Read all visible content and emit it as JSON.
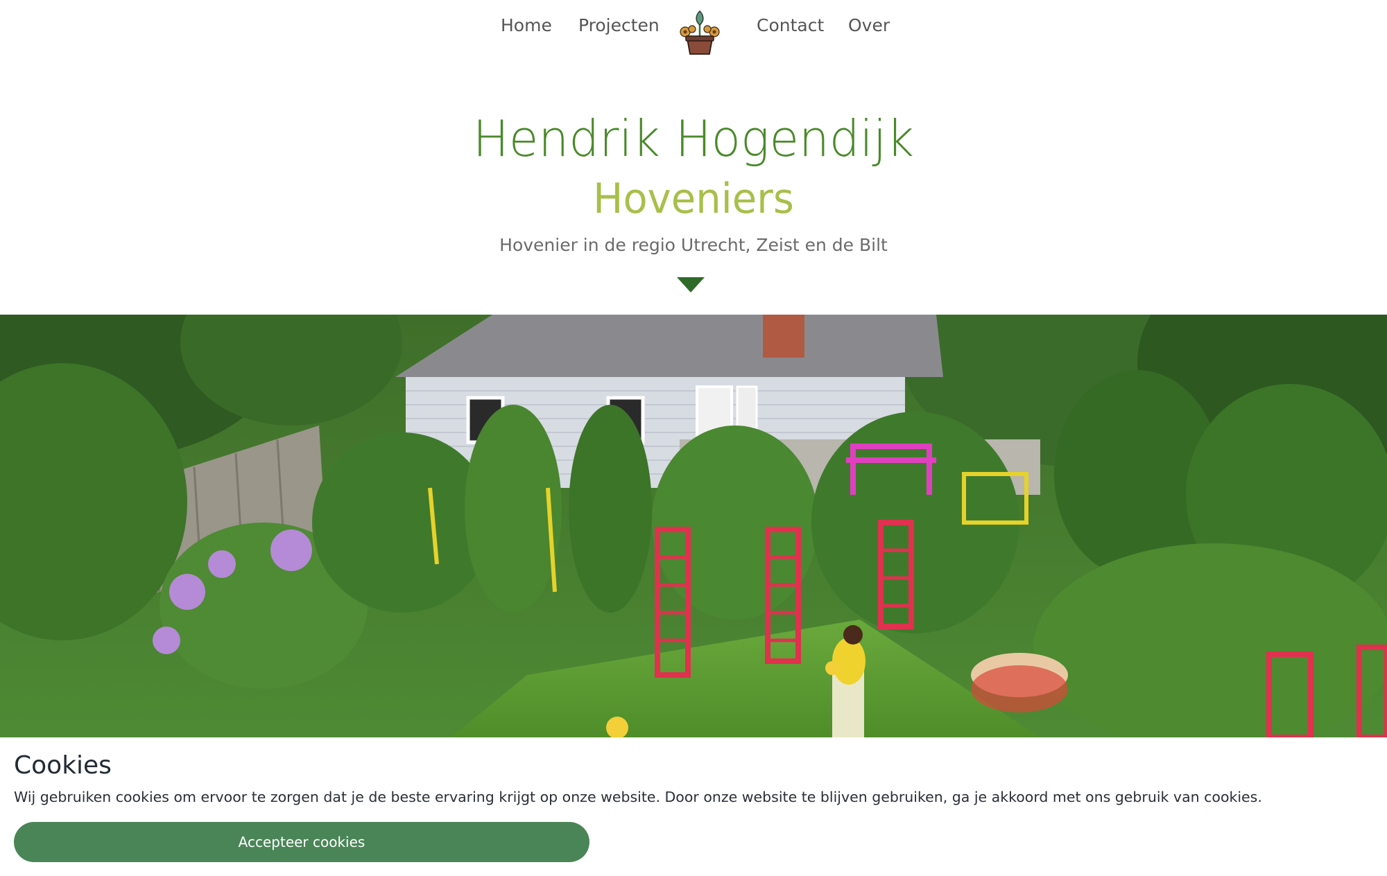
{
  "nav": {
    "items": [
      {
        "label": "Home"
      },
      {
        "label": "Projecten"
      },
      {
        "label": "Contact"
      },
      {
        "label": "Over"
      }
    ],
    "logo_icon": "flower-pot-logo-icon"
  },
  "hero": {
    "title": "Hendrik Hogendijk",
    "subtitle": "Hoveniers",
    "tagline": "Hovenier in de regio Utrecht, Zeist en de Bilt",
    "scroll_icon": "triangle-down-icon"
  },
  "cookie": {
    "title": "Cookies",
    "text": "Wij gebruiken cookies om ervoor te zorgen dat je de beste ervaring krijgt op onze website. Door onze website te blijven gebruiken, ga je akkoord met ons gebruik van cookies.",
    "button_label": "Accepteer cookies"
  },
  "colors": {
    "title_green": "#4a8a2a",
    "subtitle_green": "#a8bf4a",
    "arrow_green": "#2f6a2a",
    "button_green": "#4a8557"
  }
}
